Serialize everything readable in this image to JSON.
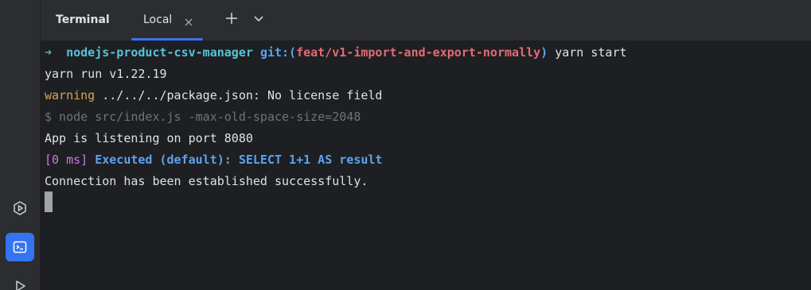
{
  "toolwindow": {
    "title": "Terminal",
    "tabs": [
      {
        "label": "Local",
        "active": true
      }
    ],
    "add_tab_symbol": "+",
    "dropdown_symbol": "⌄"
  },
  "toolstrip": {
    "icons": [
      "services-icon",
      "terminal-icon",
      "run-icon"
    ],
    "active_icon": "terminal-icon"
  },
  "terminal": {
    "prompt": {
      "arrow": "➜",
      "directory": "nodejs-product-csv-manager",
      "git_prefix": "git:(",
      "branch": "feat/v1-import-and-export-normally",
      "git_suffix": ")",
      "command": "yarn start"
    },
    "lines": {
      "yarn_run": "yarn run v1.22.19",
      "warning_keyword": "warning",
      "warning_text": " ../../../package.json: No license field",
      "node_cmd": "$ node src/index.js -max-old-space-size=2048",
      "listening": "App is listening on port 8080",
      "sql_time": "[0 ms]",
      "sql_text": " Executed (default): SELECT 1+1 AS result",
      "connection": "Connection has been established successfully."
    }
  },
  "colors": {
    "accent": "#3574f0",
    "background": "#1e1f22",
    "panel": "#2b2d30",
    "prompt_green": "#5fb87a",
    "directory_cyan": "#56c4d6",
    "git_blue": "#5ca3f0",
    "branch_red": "#e06c75",
    "warning_yellow": "#d6a65a",
    "muted_gray": "#6f737a",
    "time_magenta": "#c77dda"
  }
}
